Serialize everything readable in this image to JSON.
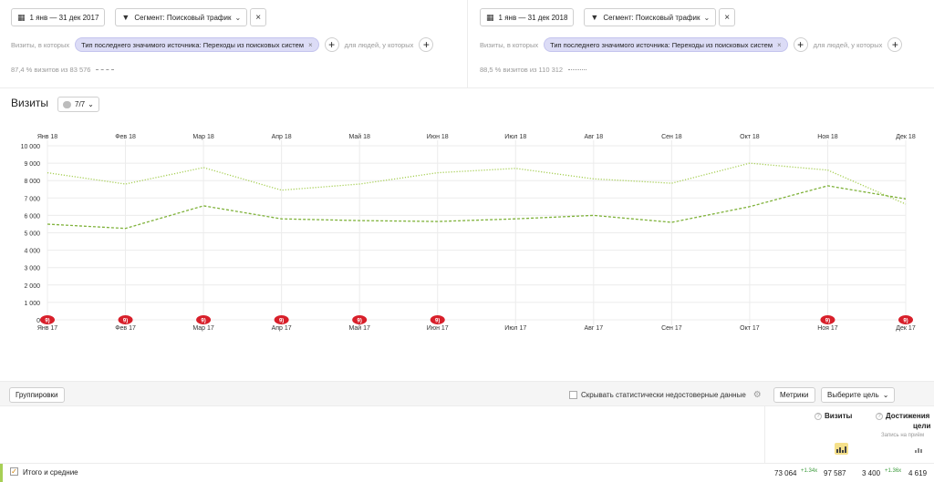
{
  "left_panel": {
    "date_range": "1 янв — 31 дек 2017",
    "segment_label": "Сегмент: Поисковый трафик",
    "visits_in_label": "Визиты, в которых",
    "filter_chip": "Тип последнего значимого источника: Переходы из поисковых систем",
    "people_label": "для людей, у которых",
    "summary": "87,4 % визитов из 83 576"
  },
  "right_panel": {
    "date_range": "1 янв — 31 дек 2018",
    "segment_label": "Сегмент: Поисковый трафик",
    "visits_in_label": "Визиты, в которых",
    "filter_chip": "Тип последнего значимого источника: Переходы из поисковых систем",
    "people_label": "для людей, у которых",
    "summary": "88,5 % визитов из 110 312"
  },
  "chart_header": {
    "title": "Визиты",
    "series_button": "7/7"
  },
  "chart_data": {
    "type": "line",
    "x_top": [
      "Янв 18",
      "Фев 18",
      "Мар 18",
      "Апр 18",
      "Май 18",
      "Июн 18",
      "Июл 18",
      "Авг 18",
      "Сен 18",
      "Окт 18",
      "Ноя 18",
      "Дек 18"
    ],
    "x_bottom": [
      "Янв 17",
      "Фев 17",
      "Мар 17",
      "Апр 17",
      "Май 17",
      "Июн 17",
      "Июл 17",
      "Авг 17",
      "Сен 17",
      "Окт 17",
      "Ноя 17",
      "Дек 17"
    ],
    "y_ticks": [
      "0",
      "1 000",
      "2 000",
      "3 000",
      "4 000",
      "5 000",
      "6 000",
      "7 000",
      "8 000",
      "9 000",
      "10 000"
    ],
    "ylim": [
      0,
      10000
    ],
    "grid": true,
    "series": [
      {
        "values": [
          8450,
          7800,
          8750,
          7450,
          7800,
          8450,
          8700,
          8100,
          7850,
          9000,
          8600,
          6650
        ],
        "color": "#a7cf55",
        "style": "dotted"
      },
      {
        "values": [
          5500,
          5250,
          6550,
          5800,
          5700,
          5650,
          5800,
          6000,
          5600,
          6500,
          7700,
          6950
        ],
        "color": "#7fb23a",
        "style": "dashed"
      }
    ],
    "annotation_markers": [
      0,
      1,
      2,
      3,
      4,
      5,
      10,
      11
    ],
    "annotation_marker_text": "9)"
  },
  "toolbar": {
    "groupings_button": "Группировки",
    "hide_unreliable_label": "Скрывать статистически недостоверные данные",
    "metrics_button": "Метрики",
    "goal_select": "Выберите цель"
  },
  "table": {
    "col_visits": "Визиты",
    "col_goals_line1": "Достижения",
    "col_goals_line2": "цели",
    "col_goals_sub": "Запись на приём",
    "totals_label": "Итого и средние",
    "visits_2017": "73 064",
    "visits_delta": "+1.34x",
    "visits_2018": "97 587",
    "goals_2017": "3 400",
    "goals_delta": "+1.36x",
    "goals_2018": "4 619"
  },
  "colors": {
    "accent_green": "#a7cf55",
    "chip_bg": "#dcdcf6",
    "marker_red": "#d81f2a",
    "active_bar_button": "#f5e08a"
  },
  "icons": {
    "calendar": "calendar-icon",
    "segment": "funnel-icon",
    "close": "close-icon",
    "add": "plus-icon",
    "settings": "gear-icon",
    "help": "question-icon"
  }
}
